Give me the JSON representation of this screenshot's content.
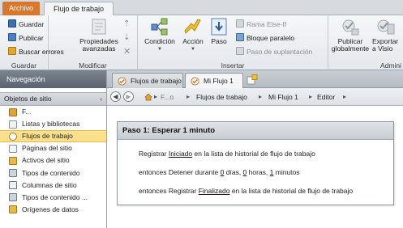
{
  "tabs": {
    "file": "Archivo",
    "workflow": "Flujo de trabajo"
  },
  "ribbon": {
    "guardar_group": {
      "label": "Guardar",
      "save": "Guardar",
      "publish": "Publicar",
      "check_errors": "Buscar errores"
    },
    "modificar_group": {
      "label": "Modificar",
      "advanced_props_line1": "Propiedades",
      "advanced_props_line2": "avanzadas"
    },
    "insertar_group": {
      "label": "Insertar",
      "condition": "Condición",
      "action": "Acción",
      "step": "Paso",
      "else_if": "Rama Else-If",
      "parallel": "Bloque paralelo",
      "impersonation": "Paso de suplantación"
    },
    "admin_group": {
      "label": "Admini",
      "publish_globally_line1": "Publicar",
      "publish_globally_line2": "globalmente",
      "export_line1": "Exportar",
      "export_line2": "a Visio"
    }
  },
  "nav": {
    "header": "Navegación",
    "section": "Objetos de sitio",
    "items": [
      {
        "label": "F...",
        "icon": "home-icon"
      },
      {
        "label": "Listas y bibliotecas",
        "icon": "list-icon"
      },
      {
        "label": "Flujos de trabajo",
        "icon": "workflow-icon"
      },
      {
        "label": "Páginas del sitio",
        "icon": "page-icon"
      },
      {
        "label": "Activos del sitio",
        "icon": "assets-icon"
      },
      {
        "label": "Tipos de contenido",
        "icon": "content-type-icon"
      },
      {
        "label": "Columnas de sitio",
        "icon": "columns-icon"
      },
      {
        "label": "Tipos de contenido ...",
        "icon": "external-content-icon"
      },
      {
        "label": "Orígenes de datos",
        "icon": "data-source-icon"
      }
    ]
  },
  "doc_tabs": [
    "Flujos de trabajo",
    "Mi Flujo 1"
  ],
  "breadcrumb": [
    "F...o",
    "Flujos de trabajo",
    "Mi Flujo 1",
    "Editor"
  ],
  "editor": {
    "step_title": "Paso 1: Esperar 1 minuto",
    "line1": {
      "pre": "Registrar ",
      "link": "Iniciado",
      "post": "  en la lista de historial de flujo de trabajo"
    },
    "line2": {
      "pre": "entonces Detener durante ",
      "days": "0",
      "days_label": " días, ",
      "hours": "0",
      "hours_label": " horas, ",
      "minutes": "1",
      "minutes_label": "  minutos"
    },
    "line3": {
      "pre": "entonces Registrar ",
      "link": "Finalizado",
      "post": "  en la lista de historial de flujo de trabajo"
    }
  },
  "colors": {
    "file_tab": "#d9782c",
    "selected_nav": "#fbe18c",
    "ribbon_bg": "#eef0f3"
  }
}
